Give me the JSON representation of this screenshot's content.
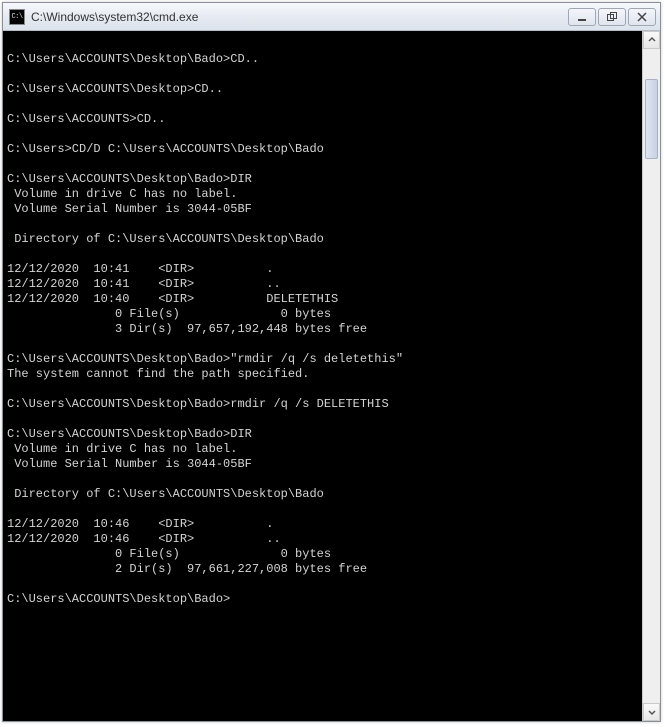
{
  "window": {
    "icon_label": "C:\\",
    "title": "C:\\Windows\\system32\\cmd.exe"
  },
  "terminal": {
    "lines": [
      "",
      "C:\\Users\\ACCOUNTS\\Desktop\\Bado>CD..",
      "",
      "C:\\Users\\ACCOUNTS\\Desktop>CD..",
      "",
      "C:\\Users\\ACCOUNTS>CD..",
      "",
      "C:\\Users>CD/D C:\\Users\\ACCOUNTS\\Desktop\\Bado",
      "",
      "C:\\Users\\ACCOUNTS\\Desktop\\Bado>DIR",
      " Volume in drive C has no label.",
      " Volume Serial Number is 3044-05BF",
      "",
      " Directory of C:\\Users\\ACCOUNTS\\Desktop\\Bado",
      "",
      "12/12/2020  10:41    <DIR>          .",
      "12/12/2020  10:41    <DIR>          ..",
      "12/12/2020  10:40    <DIR>          DELETETHIS",
      "               0 File(s)              0 bytes",
      "               3 Dir(s)  97,657,192,448 bytes free",
      "",
      "C:\\Users\\ACCOUNTS\\Desktop\\Bado>\"rmdir /q /s deletethis\"",
      "The system cannot find the path specified.",
      "",
      "C:\\Users\\ACCOUNTS\\Desktop\\Bado>rmdir /q /s DELETETHIS",
      "",
      "C:\\Users\\ACCOUNTS\\Desktop\\Bado>DIR",
      " Volume in drive C has no label.",
      " Volume Serial Number is 3044-05BF",
      "",
      " Directory of C:\\Users\\ACCOUNTS\\Desktop\\Bado",
      "",
      "12/12/2020  10:46    <DIR>          .",
      "12/12/2020  10:46    <DIR>          ..",
      "               0 File(s)              0 bytes",
      "               2 Dir(s)  97,661,227,008 bytes free",
      "",
      "C:\\Users\\ACCOUNTS\\Desktop\\Bado>"
    ]
  }
}
